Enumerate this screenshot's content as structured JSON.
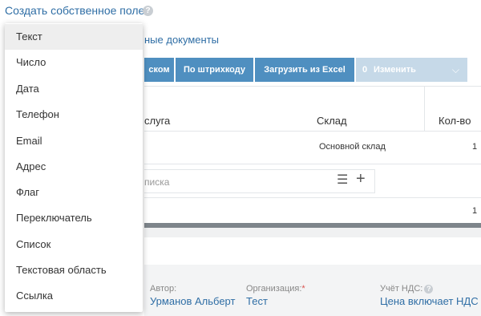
{
  "header": {
    "create_field": "Создать собственное поле",
    "help": "?"
  },
  "tabs": {
    "docs_link": "ные документы"
  },
  "toolbar": {
    "search": "ском",
    "barcode": "По штрихкоду",
    "excel": "Загрузить из Excel",
    "change_count": "0",
    "change": "Изменить",
    "chevron": "⌵"
  },
  "table": {
    "columns": [
      "слуга",
      "Склад",
      "Кол-во"
    ],
    "rows": [
      {
        "warehouse": "Основной склад",
        "qty": "1"
      }
    ],
    "add_placeholder": "писка",
    "total_qty": "1"
  },
  "icons": {
    "list": "☰",
    "plus": "+"
  },
  "footer": {
    "author_label": "Автор:",
    "author_value": "Урманов Альберт",
    "org_label": "Организация:",
    "org_required": "*",
    "org_value": "Тест",
    "vat_label": "Учёт НДС:",
    "vat_help": "?",
    "vat_value": "Цена включает НДС"
  },
  "dropdown": {
    "selected": "Текст",
    "items": [
      "Текст",
      "Число",
      "Дата",
      "Телефон",
      "Email",
      "Адрес",
      "Флаг",
      "Переключатель",
      "Список",
      "Текстовая область",
      "Ссылка"
    ]
  }
}
